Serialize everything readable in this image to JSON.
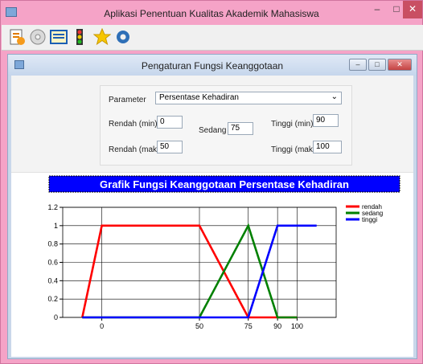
{
  "window": {
    "title": "Aplikasi Penentuan Kualitas Akademik Mahasiswa",
    "min_label": "–",
    "max_label": "□",
    "close_label": "✕"
  },
  "toolbar": {
    "icons": [
      "report-icon",
      "disc-icon",
      "list-icon",
      "traffic-light-icon",
      "star-icon",
      "gear-icon"
    ]
  },
  "form": {
    "title": "Pengaturan Fungsi Keanggotaan",
    "parameter_label": "Parameter",
    "parameter_value": "Persentase Kehadiran",
    "rendah_min_label": "Rendah (min)",
    "rendah_min_value": "0",
    "rendah_maks_label": "Rendah (maks)",
    "rendah_maks_value": "50",
    "sedang_label": "Sedang",
    "sedang_value": "75",
    "tinggi_min_label": "Tinggi (min)",
    "tinggi_min_value": "90",
    "tinggi_maks_label": "Tinggi (maks)",
    "tinggi_maks_value": "100"
  },
  "colors": {
    "rendah": "#ff0000",
    "sedang": "#008000",
    "tinggi": "#0000ff",
    "title_bg": "#0000ff"
  },
  "chart_data": {
    "type": "line",
    "title": "Grafik Fungsi Keanggotaan Persentase Kehadiran",
    "x_ticks": [
      "0",
      "50",
      "75",
      "90",
      "100"
    ],
    "x_tick_values": [
      0,
      50,
      75,
      90,
      100
    ],
    "xlim": [
      -20,
      120
    ],
    "ylim": [
      0,
      1.2
    ],
    "y_ticks": [
      "0",
      "0.2",
      "0.4",
      "0.6",
      "0.8",
      "1",
      "1.2"
    ],
    "grid": true,
    "legend_position": "top-right",
    "series": [
      {
        "name": "rendah",
        "color": "#ff0000",
        "x": [
          -10,
          0,
          50,
          75,
          100
        ],
        "y": [
          0,
          1,
          1,
          0,
          0
        ]
      },
      {
        "name": "sedang",
        "color": "#008000",
        "x": [
          -10,
          50,
          75,
          90,
          100
        ],
        "y": [
          0,
          0,
          1,
          0,
          0
        ]
      },
      {
        "name": "tinggi",
        "color": "#0000ff",
        "x": [
          -10,
          75,
          90,
          100,
          110
        ],
        "y": [
          0,
          0,
          1,
          1,
          1
        ]
      }
    ]
  }
}
